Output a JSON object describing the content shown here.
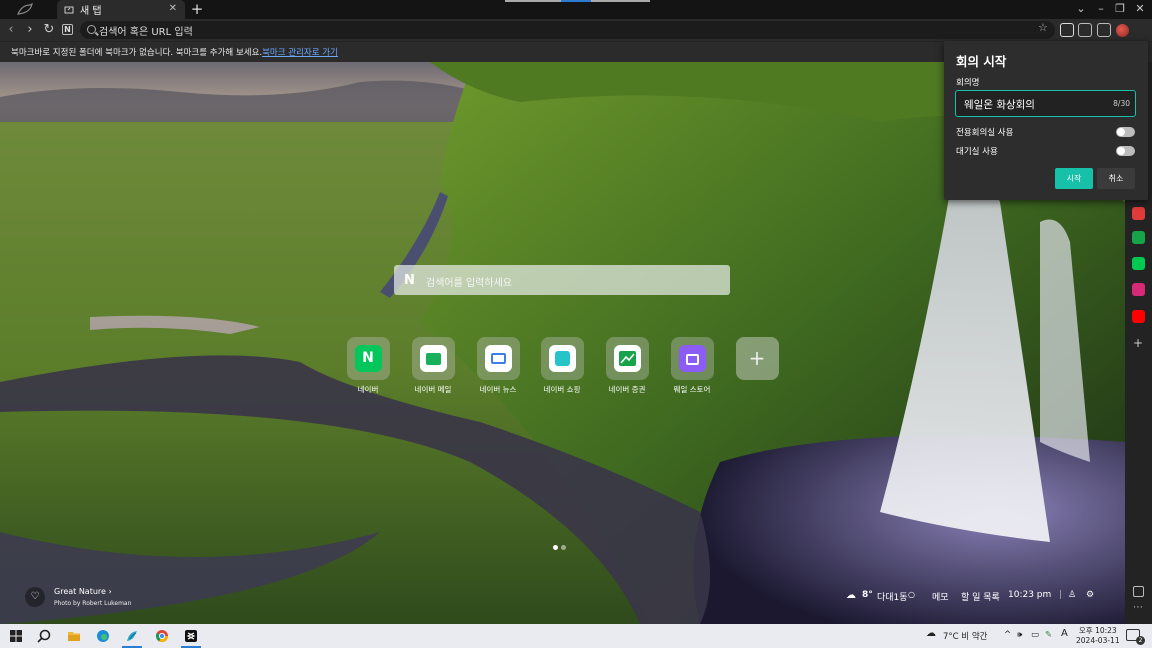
{
  "tab": {
    "title": "새 탭",
    "new_tab": "+"
  },
  "window": {
    "minimize": "–",
    "restore": "❐",
    "close": "✕",
    "dropdown": "⌄"
  },
  "toolbar": {
    "back": "‹",
    "forward": "›",
    "reload": "↻",
    "home": "N",
    "address_placeholder": "검색어 혹은 URL 입력",
    "menu": "⋮"
  },
  "bookmark_bar": {
    "message": "북마크바로 지정된 폴더에 북마크가 없습니다. 북마크를 추가해 보세요.",
    "link": "북마크 관리자로 가기"
  },
  "new_tab_page": {
    "search": {
      "logo": "N",
      "placeholder": "검색어를 입력하세요"
    },
    "shortcuts": [
      {
        "label": "네이버",
        "icon": "naver-icon",
        "color": "#03c75a"
      },
      {
        "label": "네이버 메일",
        "icon": "naver-mail-icon",
        "color": "#19b05c"
      },
      {
        "label": "네이버 뉴스",
        "icon": "naver-news-icon",
        "color": "#3f7de8"
      },
      {
        "label": "네이버 쇼핑",
        "icon": "naver-shopping-icon",
        "color": "#25c4c8"
      },
      {
        "label": "네이버 증권",
        "icon": "naver-stock-icon",
        "color": "#16a34a"
      },
      {
        "label": "웨일 스토어",
        "icon": "whale-store-icon",
        "color": "#8b5cf6"
      },
      {
        "label": "+",
        "icon": "add-shortcut-icon",
        "color": "#9a9a9a"
      }
    ],
    "page_dots": 2,
    "credit": {
      "title": "Great Nature",
      "photo": "Photo by Robert Lukeman"
    },
    "widgets": {
      "temperature": "8°",
      "location": "다대1동",
      "memo": "메모",
      "todo": "할 일 목록",
      "time": "10:23 pm"
    }
  },
  "meeting_panel": {
    "title": "회의 시작",
    "name_label": "회의명",
    "name_value": "웨일온 화상회의",
    "char_count": "8/30",
    "option_dedicated": "전용회의실 사용",
    "option_waiting": "대기실 사용",
    "dedicated_on": false,
    "waiting_on": false,
    "start": "시작",
    "cancel": "취소",
    "accent": "#17c0a8"
  },
  "sidebar_apps": [
    {
      "icon": "calendar-icon",
      "color": "#e03b3b"
    },
    {
      "icon": "stock-icon",
      "color": "#16a34a"
    },
    {
      "icon": "webtoon-icon",
      "color": "#00c853"
    },
    {
      "icon": "instagram-icon",
      "color": "#d62976"
    },
    {
      "icon": "youtube-icon",
      "color": "#ff0000"
    }
  ],
  "taskbar": {
    "weather": "7°C 비 약간",
    "ime": "A",
    "time": "오후 10:23",
    "date": "2024-03-11",
    "notifications": "2"
  }
}
